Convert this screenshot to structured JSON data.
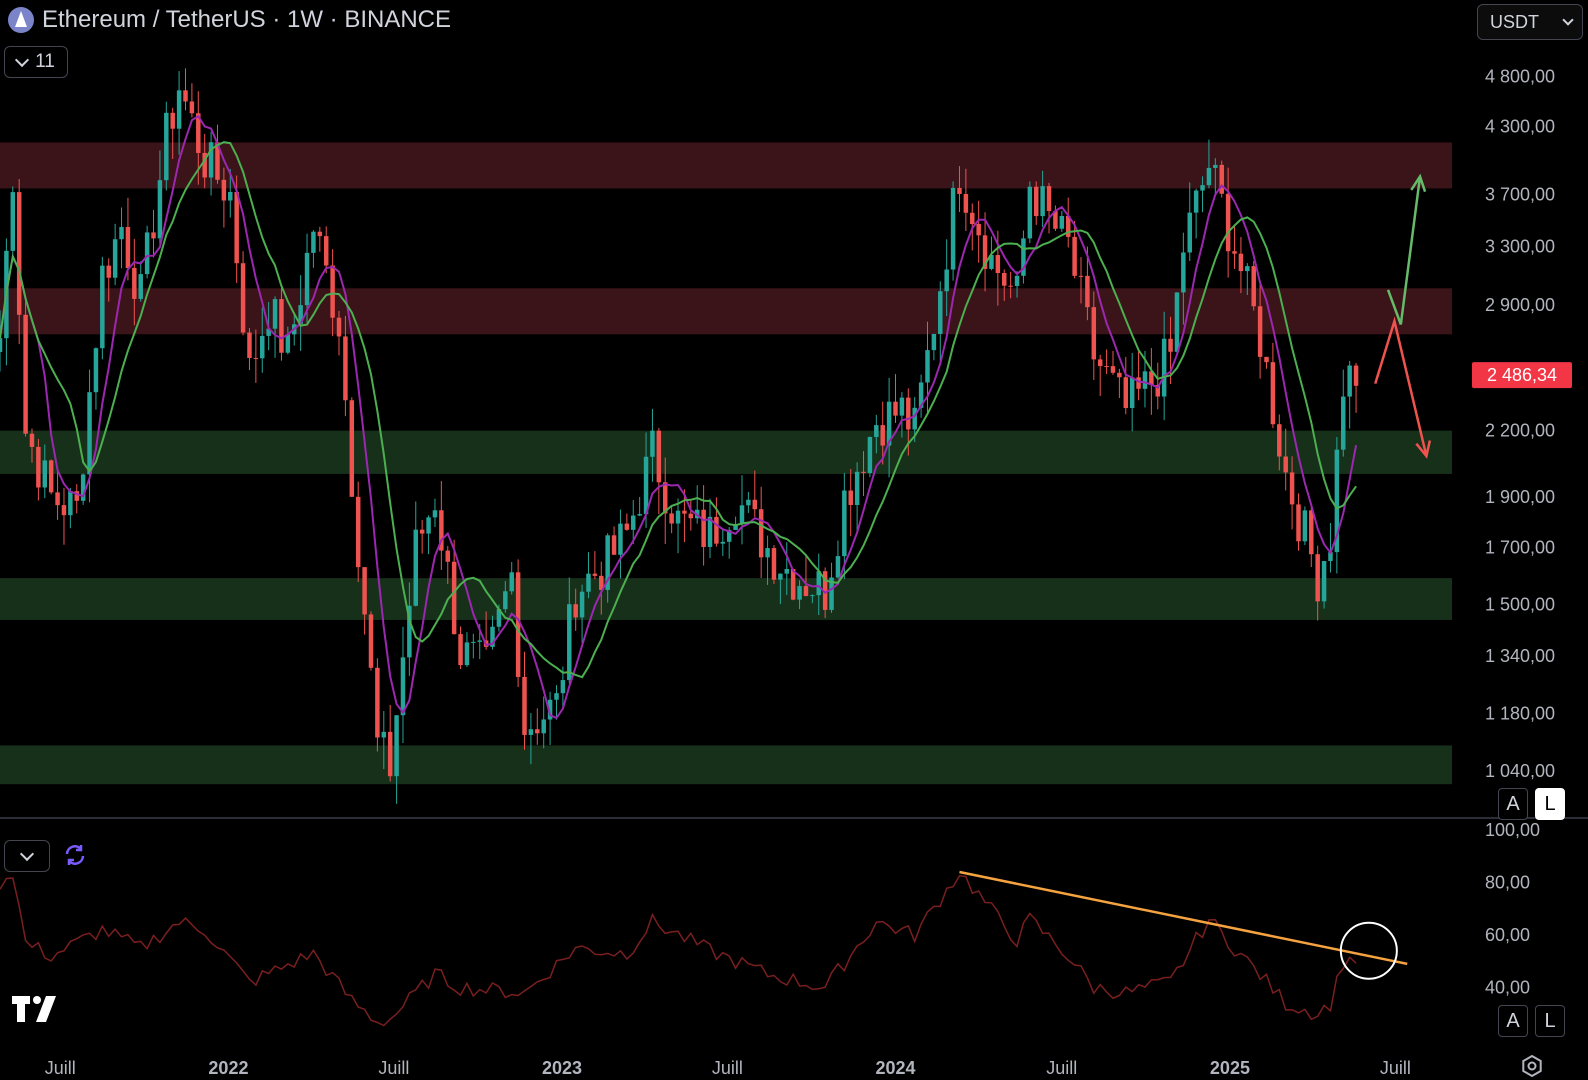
{
  "header": {
    "title": "Ethereum / TetherUS · 1W · BINANCE",
    "indicator_count": "11",
    "currency": "USDT"
  },
  "price_pane": {
    "y_ticks": [
      "4 800,00",
      "4 300,00",
      "3 700,00",
      "3 300,00",
      "2 900,00",
      "2 486,34",
      "2 200,00",
      "1 900,00",
      "1 700,00",
      "1 500,00",
      "1 340,00",
      "1 180,00",
      "1 040,00"
    ],
    "current_price": "2 486,34",
    "buttons": {
      "auto": "A",
      "log": "L"
    }
  },
  "rsi_pane": {
    "y_ticks": [
      "100,00",
      "80,00",
      "60,00",
      "40,00"
    ],
    "buttons": {
      "auto": "A",
      "log": "L"
    }
  },
  "x_axis": [
    "Juill",
    "2022",
    "Juill",
    "2023",
    "Juill",
    "2024",
    "Juill",
    "2025",
    "Juill"
  ],
  "colors": {
    "up": "#26a69a",
    "down": "#ef5350",
    "ma_fast": "#9c27b0",
    "ma_slow": "#4caf50",
    "resistance_zone": "#3a1418",
    "support_zone": "#17301a",
    "rsi_line": "#7a1f1f",
    "trendline": "#f5a340",
    "price_badge": "#f23645",
    "arrow_up": "#66bb6a",
    "arrow_down": "#ef5350"
  },
  "chart_data": {
    "type": "candlestick",
    "title": "Ethereum / TetherUS · 1W · BINANCE",
    "interval": "1W",
    "scale": "log",
    "y_range": [
      950,
      5200
    ],
    "x_range": [
      "2021-04-26",
      "2025-09-01"
    ],
    "zones": [
      {
        "kind": "resistance",
        "from": 3750,
        "to": 4150
      },
      {
        "kind": "resistance",
        "from": 2720,
        "to": 3010
      },
      {
        "kind": "support",
        "from": 2000,
        "to": 2200
      },
      {
        "kind": "support",
        "from": 1450,
        "to": 1590
      },
      {
        "kind": "support",
        "from": 1010,
        "to": 1100
      }
    ],
    "price_path": [
      [
        "2021-04-26",
        2700
      ],
      [
        "2021-05-10",
        3900
      ],
      [
        "2021-05-24",
        2200
      ],
      [
        "2021-06-21",
        1900
      ],
      [
        "2021-07-19",
        1850
      ],
      [
        "2021-08-16",
        3100
      ],
      [
        "2021-09-06",
        3450
      ],
      [
        "2021-09-27",
        2950
      ],
      [
        "2021-10-25",
        4200
      ],
      [
        "2021-11-08",
        4700
      ],
      [
        "2021-12-06",
        4000
      ],
      [
        "2022-01-03",
        3700
      ],
      [
        "2022-01-24",
        2500
      ],
      [
        "2022-02-14",
        2900
      ],
      [
        "2022-03-07",
        2600
      ],
      [
        "2022-04-04",
        3450
      ],
      [
        "2022-05-02",
        2800
      ],
      [
        "2022-05-16",
        2000
      ],
      [
        "2022-06-13",
        1100
      ],
      [
        "2022-06-27",
        1050
      ],
      [
        "2022-07-25",
        1700
      ],
      [
        "2022-08-15",
        1900
      ],
      [
        "2022-09-12",
        1350
      ],
      [
        "2022-10-10",
        1300
      ],
      [
        "2022-11-07",
        1600
      ],
      [
        "2022-11-21",
        1150
      ],
      [
        "2022-12-26",
        1200
      ],
      [
        "2023-01-16",
        1550
      ],
      [
        "2023-02-20",
        1650
      ],
      [
        "2023-03-13",
        1750
      ],
      [
        "2023-04-10",
        2100
      ],
      [
        "2023-05-08",
        1800
      ],
      [
        "2023-06-12",
        1750
      ],
      [
        "2023-07-10",
        1900
      ],
      [
        "2023-08-14",
        1700
      ],
      [
        "2023-09-11",
        1600
      ],
      [
        "2023-10-16",
        1550
      ],
      [
        "2023-11-06",
        1900
      ],
      [
        "2023-12-11",
        2250
      ],
      [
        "2024-01-08",
        2300
      ],
      [
        "2024-01-22",
        2200
      ],
      [
        "2024-02-12",
        2800
      ],
      [
        "2024-03-11",
        3900
      ],
      [
        "2024-04-15",
        3200
      ],
      [
        "2024-05-13",
        2950
      ],
      [
        "2024-05-27",
        3800
      ],
      [
        "2024-06-17",
        3500
      ],
      [
        "2024-07-08",
        3300
      ],
      [
        "2024-08-05",
        2600
      ],
      [
        "2024-09-09",
        2300
      ],
      [
        "2024-10-07",
        2450
      ],
      [
        "2024-10-28",
        2600
      ],
      [
        "2024-11-11",
        3300
      ],
      [
        "2024-12-09",
        3950
      ],
      [
        "2025-01-06",
        3300
      ],
      [
        "2025-02-03",
        2700
      ],
      [
        "2025-03-03",
        2000
      ],
      [
        "2025-04-07",
        1600
      ],
      [
        "2025-04-21",
        1750
      ],
      [
        "2025-05-05",
        2450
      ],
      [
        "2025-05-19",
        2486.34
      ]
    ],
    "moving_averages": [
      {
        "name": "MA fast",
        "color": "#9c27b0"
      },
      {
        "name": "MA slow",
        "color": "#4caf50"
      }
    ],
    "rsi": {
      "y_range": [
        20,
        100
      ],
      "path": [
        [
          "2021-04-26",
          80
        ],
        [
          "2021-05-10",
          84
        ],
        [
          "2021-05-24",
          57
        ],
        [
          "2021-06-21",
          52
        ],
        [
          "2021-08-16",
          62
        ],
        [
          "2021-09-27",
          55
        ],
        [
          "2021-11-08",
          65
        ],
        [
          "2021-12-06",
          62
        ],
        [
          "2022-01-24",
          42
        ],
        [
          "2022-04-04",
          53
        ],
        [
          "2022-05-16",
          35
        ],
        [
          "2022-06-13",
          27
        ],
        [
          "2022-06-27",
          28
        ],
        [
          "2022-08-15",
          45
        ],
        [
          "2022-09-12",
          40
        ],
        [
          "2022-11-21",
          38
        ],
        [
          "2023-01-16",
          55
        ],
        [
          "2023-03-13",
          53
        ],
        [
          "2023-04-10",
          65
        ],
        [
          "2023-06-12",
          54
        ],
        [
          "2023-08-14",
          45
        ],
        [
          "2023-10-16",
          40
        ],
        [
          "2023-12-11",
          65
        ],
        [
          "2024-01-22",
          60
        ],
        [
          "2024-03-11",
          84
        ],
        [
          "2024-05-13",
          58
        ],
        [
          "2024-05-27",
          66
        ],
        [
          "2024-07-08",
          52
        ],
        [
          "2024-08-05",
          40
        ],
        [
          "2024-09-09",
          38
        ],
        [
          "2024-10-28",
          42
        ],
        [
          "2024-12-09",
          66
        ],
        [
          "2025-01-06",
          55
        ],
        [
          "2025-02-03",
          45
        ],
        [
          "2025-03-03",
          34
        ],
        [
          "2025-04-07",
          30
        ],
        [
          "2025-04-21",
          34
        ],
        [
          "2025-05-05",
          50
        ],
        [
          "2025-05-19",
          51
        ]
      ],
      "trendline": [
        [
          "2024-03-11",
          84
        ],
        [
          "2025-07-14",
          49
        ]
      ]
    },
    "annotations": [
      {
        "type": "arrow-up",
        "color": "#66bb6a",
        "from": [
          "2025-06-23",
          3000
        ],
        "via": [
          "2025-07-07",
          2780
        ],
        "to": [
          "2025-07-28",
          3850
        ]
      },
      {
        "type": "arrow-down",
        "color": "#ef5350",
        "from": [
          "2025-06-09",
          2440
        ],
        "via": [
          "2025-06-30",
          2800
        ],
        "to": [
          "2025-08-04",
          2080
        ]
      },
      {
        "type": "circle",
        "pane": "rsi",
        "at": [
          "2025-06-02",
          54
        ]
      }
    ]
  }
}
